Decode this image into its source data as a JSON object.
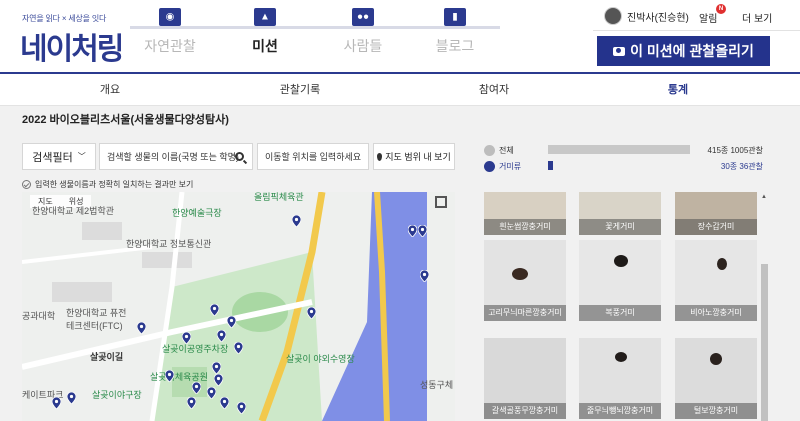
{
  "header": {
    "tagline": "자연을 읽다 × 세상을 잇다",
    "logo": "네이처링",
    "nav": [
      {
        "label": "자연관찰",
        "icon": "camera-icon",
        "active": false
      },
      {
        "label": "미션",
        "icon": "flag-icon",
        "active": true
      },
      {
        "label": "사람들",
        "icon": "people-icon",
        "active": false
      },
      {
        "label": "블로그",
        "icon": "blog-icon",
        "active": false
      }
    ],
    "user_name": "진박사(진승현)",
    "alarm_label": "알림",
    "alarm_badge": "N",
    "more_label": "더 보기",
    "upload_button": "이 미션에 관찰올리기"
  },
  "tabs": [
    {
      "label": "개요",
      "active": false
    },
    {
      "label": "관찰기록",
      "active": false
    },
    {
      "label": "참여자",
      "active": false
    },
    {
      "label": "통계",
      "active": true
    }
  ],
  "main": {
    "title": "2022 바이오블리츠서울(서울생물다양성탐사)",
    "filter_button": "검색필터",
    "search_placeholder": "검색할 생물의 이름(국명 또는 학명)",
    "location_placeholder": "이동할 위치를 입력하세요",
    "map_range_button": "지도 범위 내 보기",
    "exact_match_label": "입력한 생물이름과 정확히 일치하는 결과만 보기"
  },
  "map": {
    "toggle": [
      "지도",
      "위성"
    ],
    "labels": {
      "rink": "올림픽체육관",
      "art": "한양예술극장",
      "univ2": "한양대학교 제2법학관",
      "univ1": "한양대학교 제1법학관",
      "info": "한양대학교 정보통신관",
      "fusion": "한양대학교 퓨전",
      "tech": "테크센터(FTC)",
      "park": "살곶이공영주차장",
      "pool": "살곶이 야외수영장",
      "road": "살곶이길",
      "baseball": "살곶이야구장",
      "stadium": "살곶이체육공원",
      "engineering": "공과대학",
      "skate": "케이트파크",
      "seongdong": "성동구체"
    }
  },
  "stats": {
    "total_label": "전체",
    "total_value": "415종 1005관찰",
    "spider_label": "거미류",
    "spider_value": "30종 36관찰",
    "spider_fraction": 0.036
  },
  "gallery": [
    {
      "name": "흰눈썹깡충거미"
    },
    {
      "name": "꽃게거미"
    },
    {
      "name": "장수갑거미"
    },
    {
      "name": "고리무늬마른깡충거미"
    },
    {
      "name": "복풍거미"
    },
    {
      "name": "비아노깡충거미"
    },
    {
      "name": "갈색골풍무깡충거미"
    },
    {
      "name": "줄무늬뺑뇌깡충거미"
    },
    {
      "name": "털보깡충거미"
    }
  ],
  "colors": {
    "brand": "#2b3a8f",
    "button": "#24338c",
    "river": "#7f8fe6",
    "road": "#f2c94c"
  }
}
